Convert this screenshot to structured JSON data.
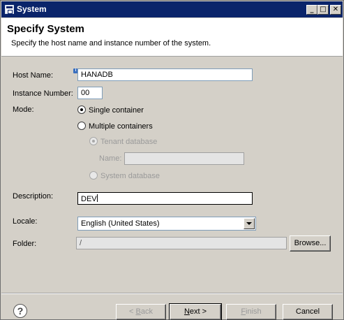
{
  "window": {
    "title": "System",
    "controls": {
      "minimize": "_",
      "maximize": "□",
      "close": "✕"
    }
  },
  "header": {
    "title": "Specify System",
    "description": "Specify the host name and instance number of the system."
  },
  "form": {
    "host_name": {
      "label": "Host Name:",
      "value": "HANADB",
      "info_icon": "i"
    },
    "instance_number": {
      "label": "Instance Number:",
      "value": "00"
    },
    "mode": {
      "label": "Mode:",
      "options": {
        "single": {
          "label": "Single container",
          "checked": true
        },
        "multiple": {
          "label": "Multiple containers",
          "checked": false
        },
        "tenant": {
          "label": "Tenant database",
          "checked": true,
          "enabled": false
        },
        "tenant_name": {
          "label": "Name:",
          "value": ""
        },
        "system_db": {
          "label": "System database",
          "checked": false,
          "enabled": false
        }
      }
    },
    "description": {
      "label": "Description:",
      "value": "DEV"
    },
    "locale": {
      "label": "Locale:",
      "value": "English (United States)"
    },
    "folder": {
      "label": "Folder:",
      "value": "/",
      "browse": "Browse..."
    }
  },
  "footer": {
    "help_icon": "?",
    "back": {
      "pre": "< ",
      "mn": "B",
      "post": "ack"
    },
    "next": {
      "mn": "N",
      "post": "ext >"
    },
    "finish": {
      "mn": "F",
      "post": "inish"
    },
    "cancel": "Cancel"
  },
  "colors": {
    "title_bar": "#0a246a",
    "dialog_bg": "#d4d0c8",
    "header_bg": "#ffffff",
    "input_border": "#7f9db9"
  }
}
